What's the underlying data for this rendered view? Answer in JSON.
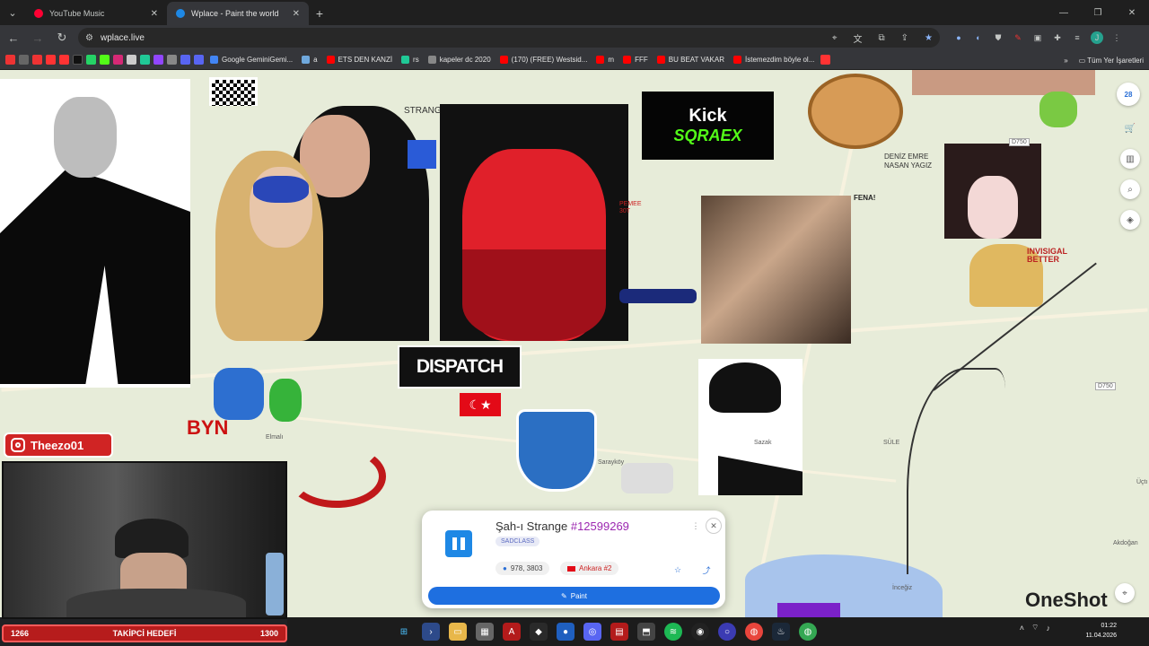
{
  "browser": {
    "tabs": [
      {
        "title": "YouTube Music",
        "active": false,
        "fav_color": "#ff0033"
      },
      {
        "title": "Wplace - Paint the world",
        "active": true,
        "fav_color": "#1e88e5"
      }
    ],
    "url": "wplace.live"
  },
  "bookmarks": [
    {
      "label": "Google GeminiGemi...",
      "color": "#4285f4"
    },
    {
      "label": "a",
      "color": "#d44"
    },
    {
      "label": "ETS DEN KANZİ",
      "color": "#ff0000"
    },
    {
      "label": "rs",
      "color": "#20c997"
    },
    {
      "label": "kapeler dc 2020",
      "color": "#888"
    },
    {
      "label": "(170) (FREE) Westsid...",
      "color": "#ff0000"
    },
    {
      "label": "m",
      "color": "#ff0000"
    },
    {
      "label": "FFF",
      "color": "#ff0000"
    },
    {
      "label": "BU  BEAT VAKAR",
      "color": "#ff0000"
    },
    {
      "label": "İstemezdim böyle ol...",
      "color": "#ff0000"
    }
  ],
  "bookmarks_all": "Tüm Yer İşaretleri",
  "canvas_texts": {
    "strange": "STRANGE",
    "kick_title": "Kick",
    "kick_sub": "SQRAEX",
    "dispatch": "DISPATCH",
    "byn": "BYN",
    "invisigal": "INVISIGAL BETTER",
    "deniz": "DENİZ EMRE NASAN YAGIZ",
    "fena": "FENA!",
    "pemee": "PEMEE 30T",
    "oneshot": "OneShot",
    "elmali": "Elmalı",
    "saraykoy": "Sarayköy",
    "sazak": "Sazak",
    "akdogan": "Akdoğan",
    "incegiz": "İnceğiz",
    "d750a": "D750",
    "d750b": "D750",
    "sule": "SÜLE",
    "ucti": "Üçtı",
    "badge28": "28"
  },
  "overlay": {
    "instagram": "Theezo01",
    "follower_current": "1266",
    "follower_label": "TAKİPCİ HEDEFİ",
    "follower_target": "1300"
  },
  "pixel_card": {
    "name": "Şah-ı Strange",
    "id": "#12599269",
    "tag": "SADCLASS",
    "coords": "978, 3803",
    "region": "Ankara #2",
    "paint_label": "Paint"
  },
  "taskbar": {
    "time": "01:22",
    "date": "11.04.2026"
  }
}
